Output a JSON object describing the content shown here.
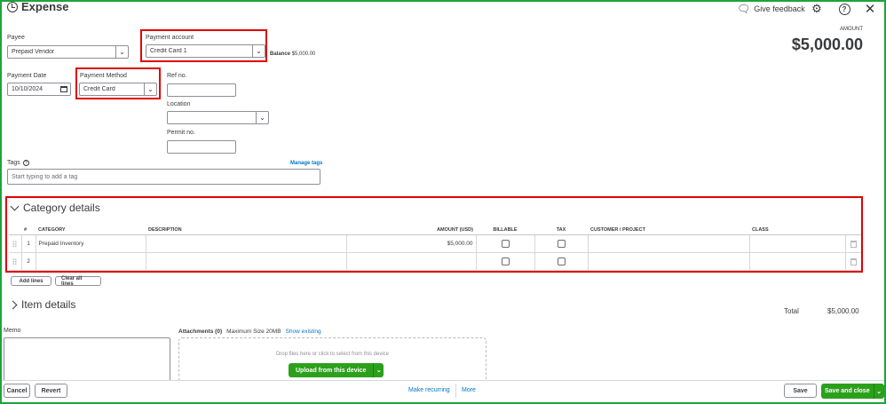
{
  "header": {
    "title": "Expense",
    "feedback_label": "Give feedback",
    "settings_icon": "gear-icon",
    "help_icon": "help-icon",
    "close_icon": "close-icon"
  },
  "form": {
    "payee_label": "Payee",
    "payee_value": "Prepaid Vendor",
    "payment_account_label": "Payment account",
    "payment_account_value": "Credit Card 1",
    "balance_label": "Balance",
    "balance_value": "$5,000.00",
    "payment_date_label": "Payment Date",
    "payment_date_value": "10/10/2024",
    "payment_method_label": "Payment Method",
    "payment_method_value": "Credit Card",
    "ref_label": "Ref no.",
    "ref_value": "",
    "location_label": "Location",
    "location_value": "",
    "permit_label": "Permit no.",
    "permit_value": "",
    "tags_label": "Tags",
    "tags_placeholder": "Start typing to add a tag",
    "manage_tags": "Manage tags"
  },
  "amount": {
    "label": "AMOUNT",
    "value": "$5,000.00"
  },
  "category_details": {
    "title": "Category details",
    "columns": [
      "#",
      "CATEGORY",
      "DESCRIPTION",
      "AMOUNT (USD)",
      "BILLABLE",
      "TAX",
      "CUSTOMER / PROJECT",
      "CLASS"
    ],
    "rows": [
      {
        "num": "1",
        "category": "Prepaid Inventory",
        "description": "",
        "amount": "$5,000.00"
      },
      {
        "num": "2",
        "category": "",
        "description": "",
        "amount": ""
      }
    ],
    "add_lines": "Add lines",
    "clear_lines": "Clear all lines"
  },
  "item_details": {
    "title": "Item details"
  },
  "totals": {
    "label": "Total",
    "value": "$5,000.00"
  },
  "memo": {
    "label": "Memo"
  },
  "attachments": {
    "label": "Attachments (0)",
    "max_size": "Maximum Size 20MB",
    "show_existing": "Show existing",
    "drop_text": "Drop files here or click to select from this device",
    "upload_button": "Upload from this device"
  },
  "footer": {
    "cancel": "Cancel",
    "revert": "Revert",
    "make_recurring": "Make recurring",
    "more": "More",
    "save": "Save",
    "save_close": "Save and close"
  },
  "colors": {
    "accent_green": "#2ca01c",
    "highlight_red": "#e00000",
    "link_blue": "#0077c5",
    "frame_green": "#1fa33a"
  }
}
